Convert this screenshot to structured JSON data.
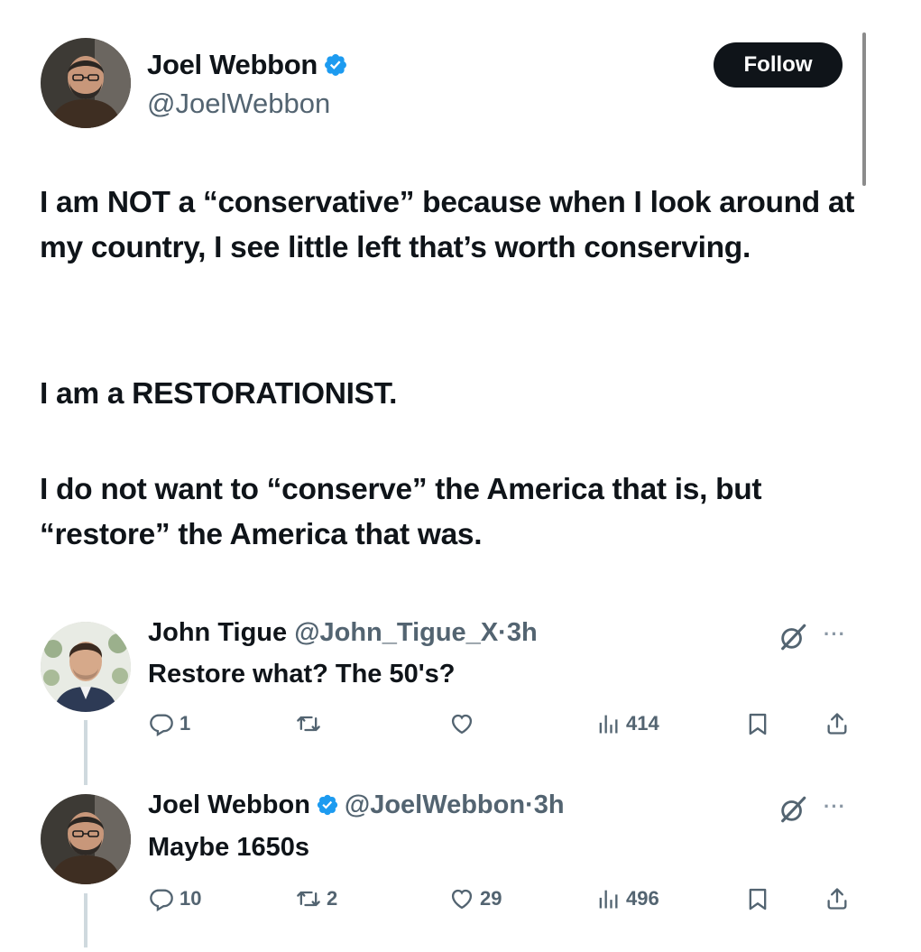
{
  "author": {
    "name": "Joel Webbon",
    "handle": "@JoelWebbon",
    "verified": true,
    "follow_label": "Follow"
  },
  "tweet": {
    "paragraphs": [
      "I am NOT a “conservative” because when I look around at my country, I see little left that’s worth conserving.",
      "I am a RESTORATIONIST.",
      "I do not want to “conserve” the America that is, but “restore” the America that was."
    ]
  },
  "replies": [
    {
      "name": "John Tigue",
      "handle": "@John_Tigue_X",
      "time": "3h",
      "verified": false,
      "text": "Restore what? The 50's?",
      "replies_count": "1",
      "retweets_count": "",
      "likes_count": "",
      "views_count": "414"
    },
    {
      "name": "Joel Webbon",
      "handle": "@JoelWebbon",
      "time": "3h",
      "verified": true,
      "text": "Maybe 1650s",
      "replies_count": "10",
      "retweets_count": "2",
      "likes_count": "29",
      "views_count": "496"
    }
  ],
  "icons": {
    "verified": "verified-badge-icon",
    "reply": "reply-icon",
    "retweet": "retweet-icon",
    "like": "heart-icon",
    "views": "views-icon",
    "bookmark": "bookmark-icon",
    "share": "share-icon",
    "grok": "grok-icon",
    "more": "more-icon"
  },
  "colors": {
    "verified": "#1d9bf0",
    "text": "#0f1419",
    "secondary": "#536471",
    "follow_bg": "#0f1419"
  }
}
